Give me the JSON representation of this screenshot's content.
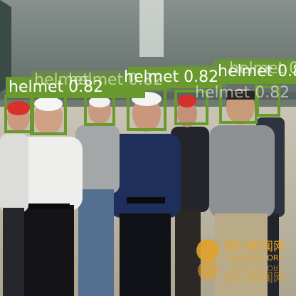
{
  "detections": [
    {
      "label": "helmet",
      "score": "0.82",
      "caption": "helmet 0.82"
    },
    {
      "label": "helmet",
      "score": "0.82",
      "caption": "helmet 0.82"
    },
    {
      "label": "helmet",
      "score": "0.82",
      "caption": "helmet 0.82"
    },
    {
      "label": "helmet",
      "score": "0.82",
      "caption": "helmet 0.82"
    }
  ],
  "ghost_captions": [
    "helmet",
    "helmet 0.82",
    "helmet 0.82",
    "helmet 0"
  ],
  "box_color": "#6a9a2e",
  "watermark": {
    "cn_line_1": "四川新闻网",
    "latin": "NEWSSC.ORG",
    "latin_mirror": "NEWSSC.ORG",
    "cn_line_2": "四川新闻网"
  }
}
